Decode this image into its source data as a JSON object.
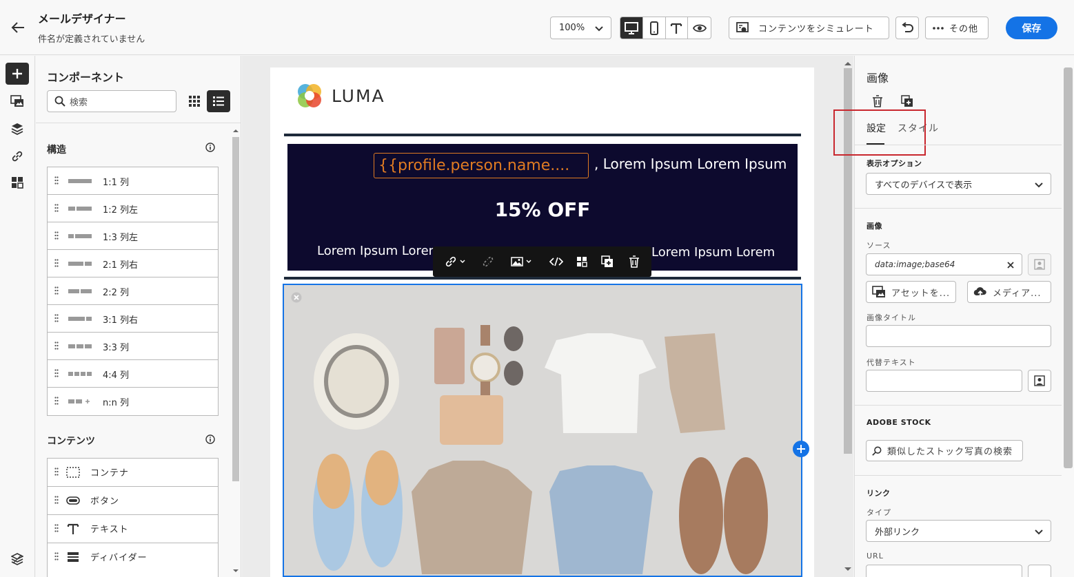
{
  "header": {
    "title": "メールデザイナー",
    "subtitle": "件名が定義されていません",
    "zoom": "100%",
    "simulate_label": "コンテンツをシミュレート",
    "more_label": "その他",
    "save_label": "保存"
  },
  "components": {
    "title": "コンポーネント",
    "search_placeholder": "検索",
    "structure": {
      "title": "構造",
      "items": [
        "1:1 列",
        "1:2 列左",
        "1:3 列左",
        "2:1 列右",
        "2:2 列",
        "3:1 列右",
        "3:3 列",
        "4:4 列",
        "n:n 列"
      ]
    },
    "content": {
      "title": "コンテンツ",
      "items": [
        "コンテナ",
        "ボタン",
        "テキスト",
        "ディバイダー"
      ]
    }
  },
  "email": {
    "logo": "LUMA",
    "token": "{{profile.person.name....",
    "greeting": ", Lorem Ipsum Lorem Ipsum",
    "headline": "15% OFF",
    "lorem_left": "Lorem Ipsum Lorem",
    "lorem_right": "Lorem Ipsum Lorem"
  },
  "properties": {
    "title": "画像",
    "tabs": [
      "設定",
      "スタイル"
    ],
    "display_options_label": "表示オプション",
    "display_options_value": "すべてのデバイスで表示",
    "image_section": "画像",
    "source_label": "ソース",
    "source_value": "data:image;base64",
    "asset_button": "アセットを...",
    "media_button": "メディア...",
    "image_title_label": "画像タイトル",
    "alt_text_label": "代替テキスト",
    "stock_section": "ADOBE STOCK",
    "stock_search": "類似したストック写真の検索",
    "link_section": "リンク",
    "type_label": "タイプ",
    "type_value": "外部リンク",
    "url_label": "URL"
  },
  "colors": {
    "accent": "#1473e6",
    "banner": "#0d0a2e",
    "token": "#e07b22",
    "highlight": "#c8262d"
  }
}
